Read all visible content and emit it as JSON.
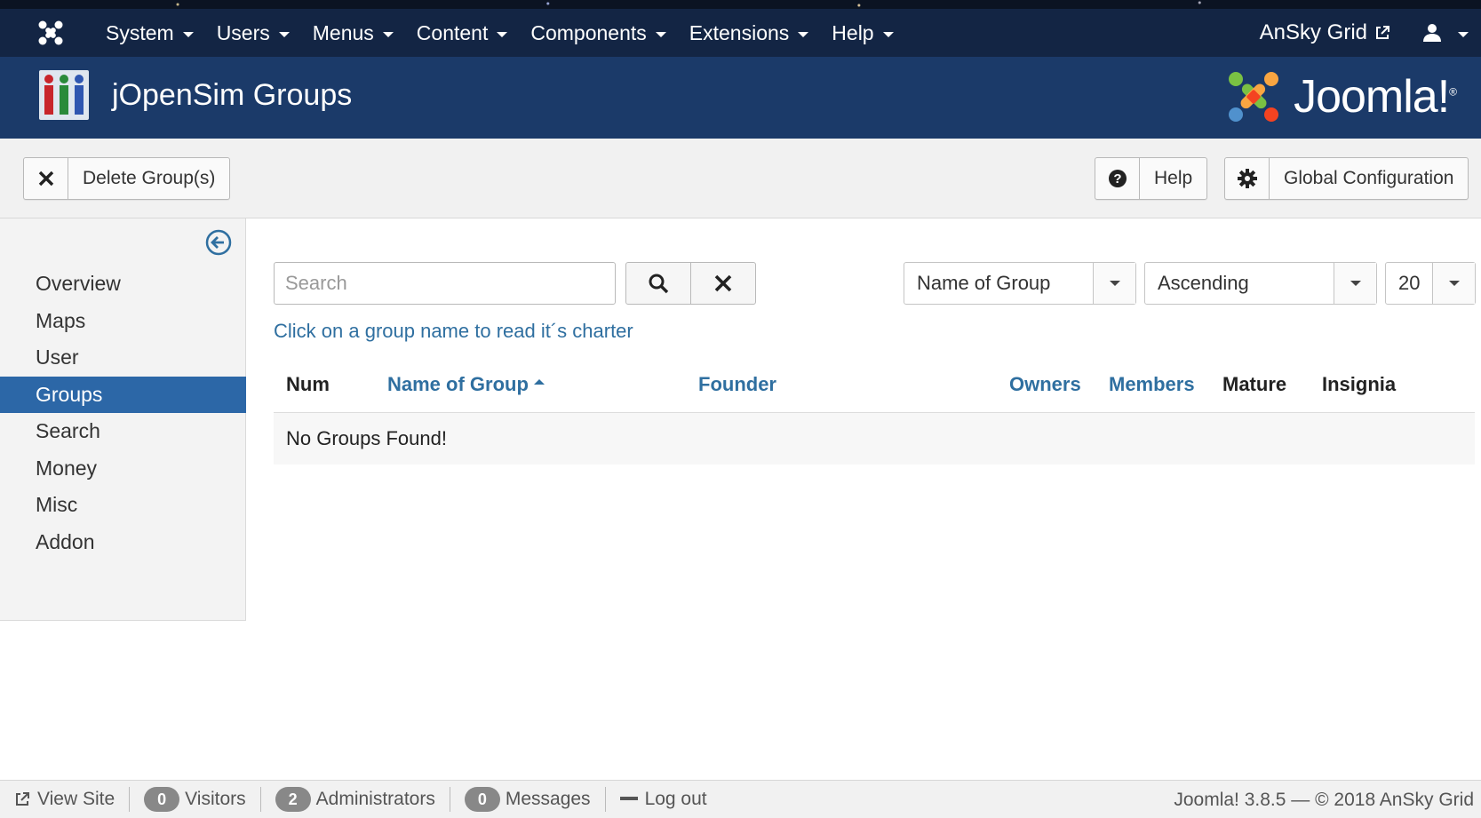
{
  "topnav": {
    "menu": [
      {
        "label": "System"
      },
      {
        "label": "Users"
      },
      {
        "label": "Menus"
      },
      {
        "label": "Content"
      },
      {
        "label": "Components"
      },
      {
        "label": "Extensions"
      },
      {
        "label": "Help"
      }
    ],
    "site_name": "AnSky Grid"
  },
  "header": {
    "title": "jOpenSim Groups",
    "brand": "Joomla!",
    "brand_reg": "®"
  },
  "toolbar": {
    "delete_label": "Delete Group(s)",
    "help_label": "Help",
    "global_config_label": "Global Configuration"
  },
  "sidebar": {
    "items": [
      {
        "label": "Overview"
      },
      {
        "label": "Maps"
      },
      {
        "label": "User"
      },
      {
        "label": "Groups"
      },
      {
        "label": "Search"
      },
      {
        "label": "Money"
      },
      {
        "label": "Misc"
      },
      {
        "label": "Addon"
      }
    ],
    "active": "Groups"
  },
  "filters": {
    "search_placeholder": "Search",
    "order_by": "Name of Group",
    "direction": "Ascending",
    "limit": "20"
  },
  "hint": "Click on a group name to read it´s charter",
  "table": {
    "columns": {
      "num": "Num",
      "name": "Name of Group",
      "founder": "Founder",
      "owners": "Owners",
      "members": "Members",
      "mature": "Mature",
      "insignia": "Insignia"
    },
    "empty_message": "No Groups Found!"
  },
  "footer": {
    "view_site": "View Site",
    "visitors_count": "0",
    "visitors_label": "Visitors",
    "admins_count": "2",
    "admins_label": "Administrators",
    "messages_count": "0",
    "messages_label": "Messages",
    "logout": "Log out",
    "copyright": "Joomla! 3.8.5  —  © 2018 AnSky Grid"
  },
  "colors": {
    "topnav_bg": "#132544",
    "header_bg": "#1b3a69",
    "active_item": "#2c67a7",
    "link": "#2f6fa0"
  }
}
